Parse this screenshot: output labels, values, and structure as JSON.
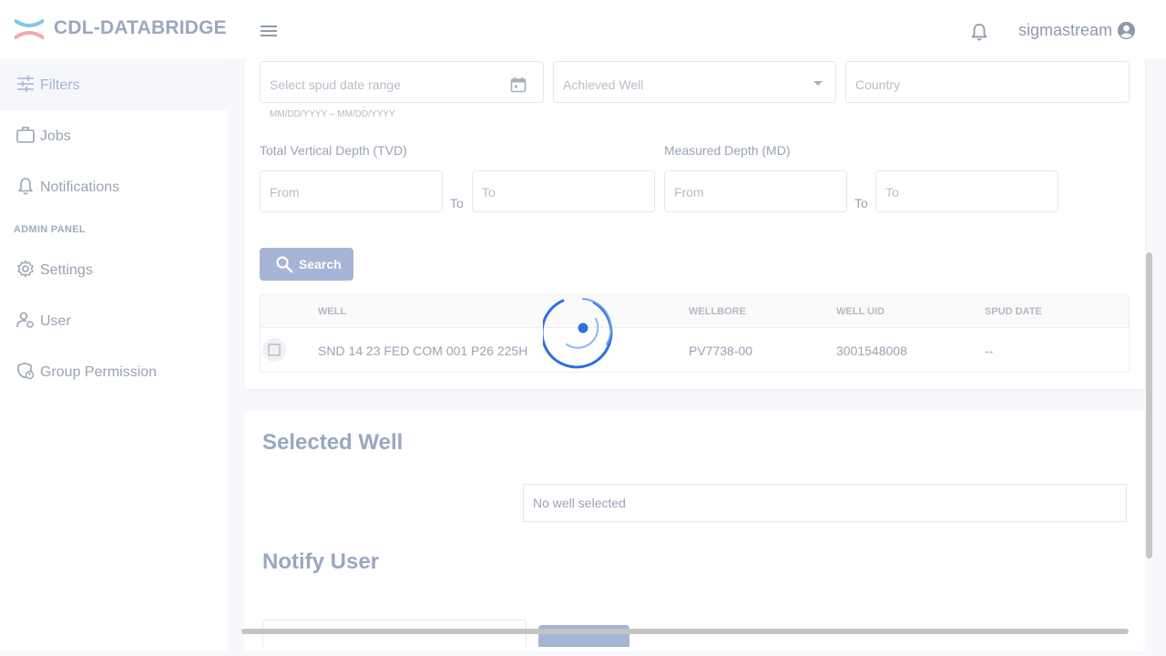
{
  "header": {
    "app_title": "CDL-DATABRIDGE",
    "username": "sigmastream"
  },
  "sidebar": {
    "items": [
      {
        "label": "Filters",
        "icon": "sliders-icon",
        "active": true
      },
      {
        "label": "Jobs",
        "icon": "briefcase-icon",
        "active": false
      },
      {
        "label": "Notifications",
        "icon": "bell-icon",
        "active": false
      }
    ],
    "admin_heading": "ADMIN PANEL",
    "admin_items": [
      {
        "label": "Settings",
        "icon": "gear-icon"
      },
      {
        "label": "User",
        "icon": "user-gear-icon"
      },
      {
        "label": "Group Permission",
        "icon": "shield-group-icon"
      }
    ]
  },
  "filters": {
    "spud_date_placeholder": "Select spud date range",
    "spud_date_hint": "MM/DD/YYYY – MM/DD/YYYY",
    "achieved_well_placeholder": "Achieved Well",
    "country_placeholder": "Country",
    "tvd_label": "Total Vertical Depth (TVD)",
    "md_label": "Measured Depth (MD)",
    "from_placeholder": "From",
    "to_placeholder": "To",
    "to_label": "To",
    "search_label": "Search"
  },
  "table": {
    "columns": [
      "WELL",
      "WELLBORE",
      "WELL UID",
      "SPUD DATE"
    ],
    "rows": [
      {
        "well": "SND 14 23 FED COM 001 P26 225H",
        "wellbore": "PV7738-00",
        "well_uid": "3001548008",
        "spud_date": "--"
      }
    ]
  },
  "selected_well": {
    "title": "Selected Well",
    "empty_text": "No well selected"
  },
  "notify_user": {
    "title": "Notify User"
  },
  "colors": {
    "accent": "#a6b5d6",
    "spinner": "#2f6fe0",
    "logo_blue": "#7ec8e8",
    "logo_pink": "#f2a7ad"
  }
}
